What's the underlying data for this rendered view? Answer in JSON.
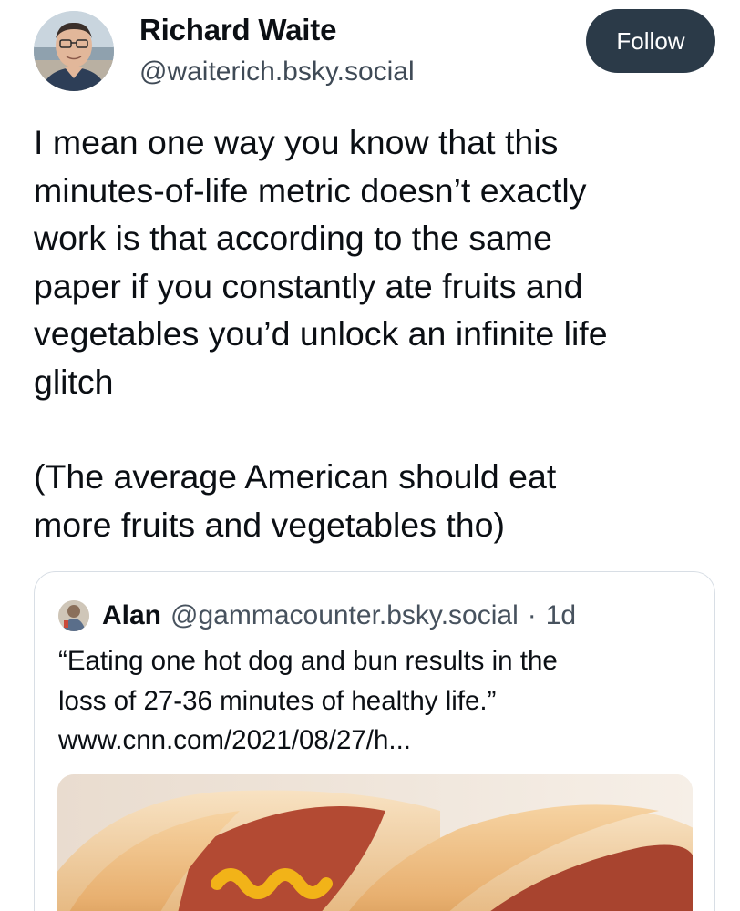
{
  "post": {
    "author": {
      "name": "Richard Waite",
      "handle": "@waiterich.bsky.social"
    },
    "follow_label": "Follow",
    "text_lines": [
      "I mean one way you know that this",
      "minutes-of-life metric doesn’t exactly",
      "work is that according to the same",
      "paper if you constantly ate fruits and",
      "vegetables you’d unlock an infinite life",
      "glitch"
    ],
    "text_lines_2": [
      "(The average American should eat",
      "more fruits and vegetables tho)"
    ]
  },
  "quote": {
    "author_name": "Alan",
    "author_handle": "@gammacounter.bsky.social",
    "separator": "·",
    "time": "1d",
    "text_lines": [
      "“Eating one hot dog and bun results in the",
      "loss of 27-36 minutes of healthy life.”",
      "www.cnn.com/2021/08/27/h..."
    ],
    "media": {
      "subject": "hot dogs with mustard",
      "colors": {
        "bun": "#e8b070",
        "sausage": "#a8442f",
        "mustard": "#f2b318"
      }
    }
  },
  "colors": {
    "follow_button_bg": "#2b3a48",
    "text": "#0b0f14",
    "secondary_text": "#3f4a56",
    "card_border": "#d8dee5"
  }
}
